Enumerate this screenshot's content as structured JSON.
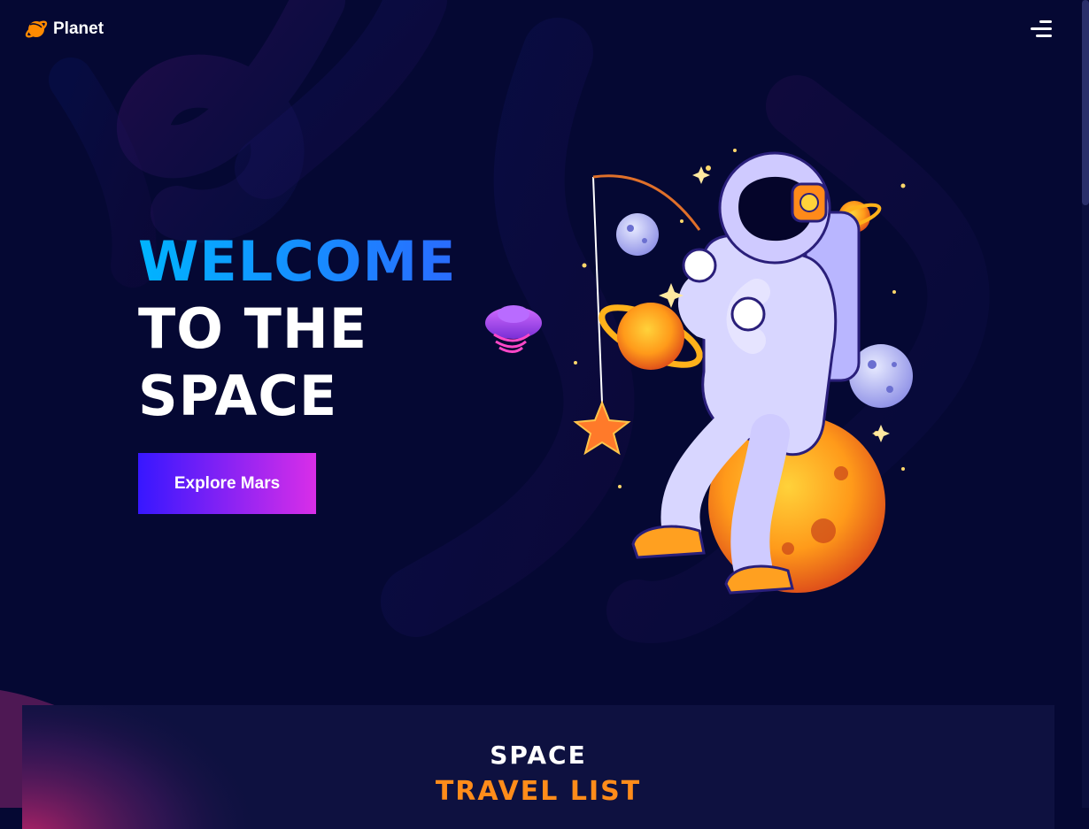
{
  "header": {
    "brand": "Planet",
    "logo_icon": "planet-icon",
    "menu_icon": "hamburger-menu-icon"
  },
  "hero": {
    "line1": "WELCOME",
    "line2": "TO THE",
    "line3": "SPACE",
    "cta_label": "Explore Mars",
    "illustration": "astronaut-fishing-planets-illustration"
  },
  "section": {
    "title_line1": "SPACE",
    "title_line2": "TRAVEL LIST"
  },
  "colors": {
    "background": "#050833",
    "accent_cyan": "#00b4ff",
    "accent_orange": "#ff8c1a",
    "button_start": "#3717ff",
    "button_end": "#d92ee8",
    "section_bg": "#0e1140"
  }
}
